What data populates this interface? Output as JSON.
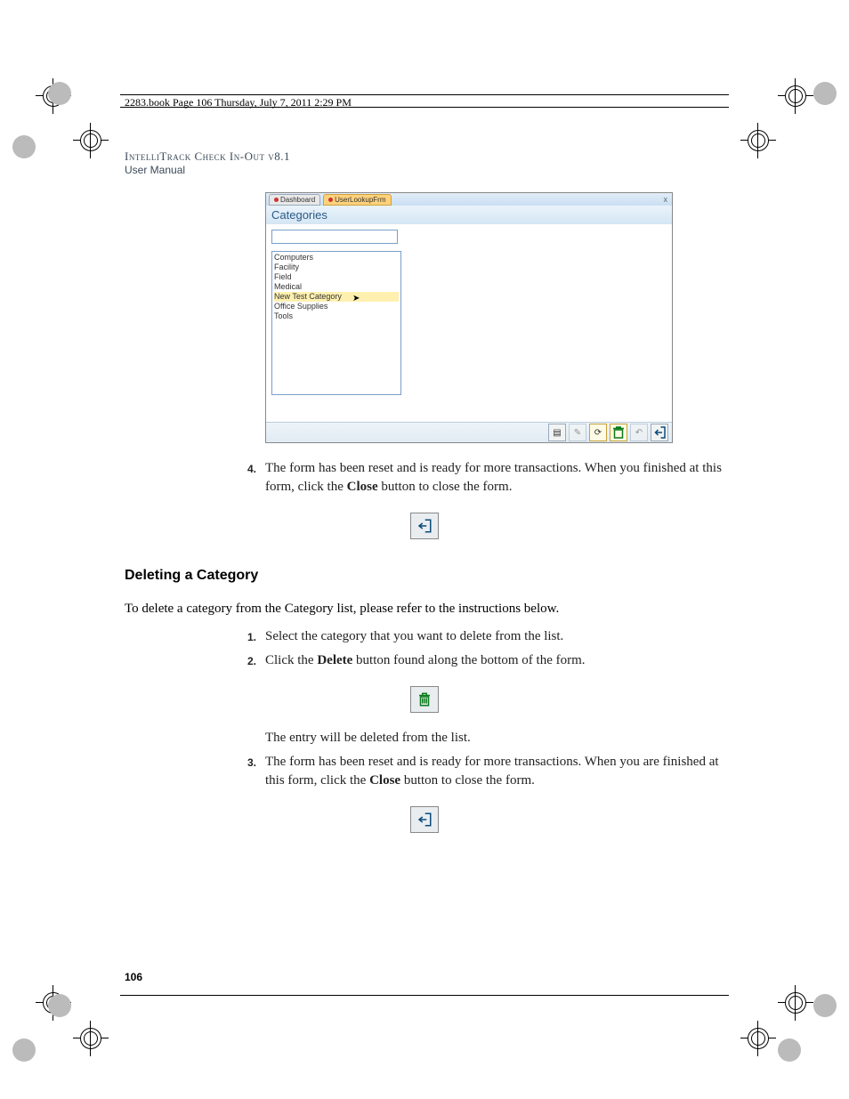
{
  "print": {
    "book_path": "2283.book  Page 106  Thursday, July 7, 2011  2:29 PM"
  },
  "header": {
    "product_line": "IntelliTrack Check In-Out v8.1",
    "subtitle": "User Manual"
  },
  "screenshot": {
    "tabs": {
      "dashboard": "Dashboard",
      "active": "UserLookupFrm",
      "close": "x"
    },
    "title": "Categories",
    "list": {
      "items": [
        "Computers",
        "Facility",
        "Field",
        "Medical",
        "New Test Category",
        "Office Supplies",
        "Tools"
      ],
      "selected_index": 4
    },
    "footer_icons": [
      "page",
      "edit",
      "refresh",
      "delete",
      "undo",
      "close"
    ]
  },
  "step4": {
    "num": "4.",
    "text_a": "The form has been reset and is ready for more transactions. When you finished at this form, click the ",
    "bold": "Close",
    "text_b": " button to close the form."
  },
  "section": {
    "heading": "Deleting a Category"
  },
  "intro": {
    "a": "To delete a category from the ",
    "bold": "Category",
    "b": " list, please refer to the instructions below."
  },
  "d1": {
    "num": "1.",
    "text": "Select the category that you want to delete from the list."
  },
  "d2": {
    "num": "2.",
    "a": "Click the ",
    "bold": "Delete",
    "b": " button found along the bottom of the form."
  },
  "d2_result": "The entry will be deleted from the list.",
  "d3": {
    "num": "3.",
    "a": "The form has been reset and is ready for more transactions. When you are finished at this form, click the ",
    "bold": "Close",
    "b": " button to close the form."
  },
  "page_number": "106"
}
